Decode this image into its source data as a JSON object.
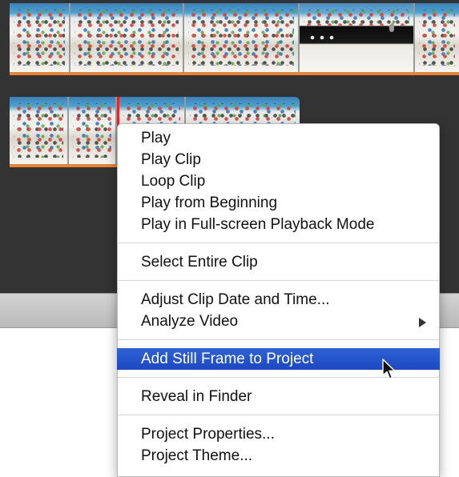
{
  "menu": {
    "groups": [
      [
        {
          "label": "Play"
        },
        {
          "label": "Play Clip"
        },
        {
          "label": "Loop Clip"
        },
        {
          "label": "Play from Beginning"
        },
        {
          "label": "Play in Full-screen Playback Mode"
        }
      ],
      [
        {
          "label": "Select Entire Clip"
        }
      ],
      [
        {
          "label": "Adjust Clip Date and Time..."
        },
        {
          "label": "Analyze Video",
          "submenu": true
        }
      ],
      [
        {
          "label": "Add Still Frame to Project",
          "highlighted": true
        }
      ],
      [
        {
          "label": "Reveal in Finder"
        }
      ],
      [
        {
          "label": "Project Properties..."
        },
        {
          "label": "Project Theme..."
        }
      ]
    ]
  },
  "colors": {
    "highlight": "#2f63d4",
    "clip_edge": "#e8843a",
    "selection_border": "#e0262b",
    "editor_background": "#333333"
  },
  "icons": {
    "submenu": "chevron-right-icon",
    "pointer": "mouse-pointer-icon"
  }
}
